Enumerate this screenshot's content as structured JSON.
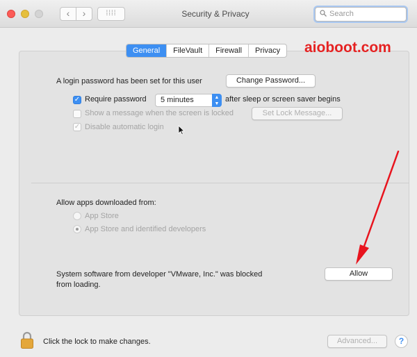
{
  "window": {
    "title": "Security & Privacy"
  },
  "search": {
    "placeholder": "Search"
  },
  "tabs": [
    {
      "label": "General",
      "active": true
    },
    {
      "label": "FileVault",
      "active": false
    },
    {
      "label": "Firewall",
      "active": false
    },
    {
      "label": "Privacy",
      "active": false
    }
  ],
  "watermark": "aioboot.com",
  "general": {
    "login_password_text": "A login password has been set for this user",
    "change_password_label": "Change Password...",
    "require_password_label": "Require password",
    "require_password_checked": true,
    "require_password_delay": "5 minutes",
    "after_sleep_text": "after sleep or screen saver begins",
    "show_message_label": "Show a message when the screen is locked",
    "show_message_checked": false,
    "set_lock_message_label": "Set Lock Message...",
    "disable_auto_login_label": "Disable automatic login",
    "disable_auto_login_checked": true
  },
  "allow_apps": {
    "heading": "Allow apps downloaded from:",
    "options": [
      {
        "label": "App Store",
        "selected": false
      },
      {
        "label": "App Store and identified developers",
        "selected": true
      }
    ]
  },
  "blocked": {
    "line1": "System software from developer \"VMware, Inc.\" was blocked",
    "line2": "from loading.",
    "allow_label": "Allow"
  },
  "footer": {
    "lock_text": "Click the lock to make changes.",
    "advanced_label": "Advanced...",
    "help_label": "?"
  },
  "colors": {
    "accent": "#3d8ff2",
    "watermark": "#e52222",
    "annotation_arrow": "#e8141e"
  }
}
